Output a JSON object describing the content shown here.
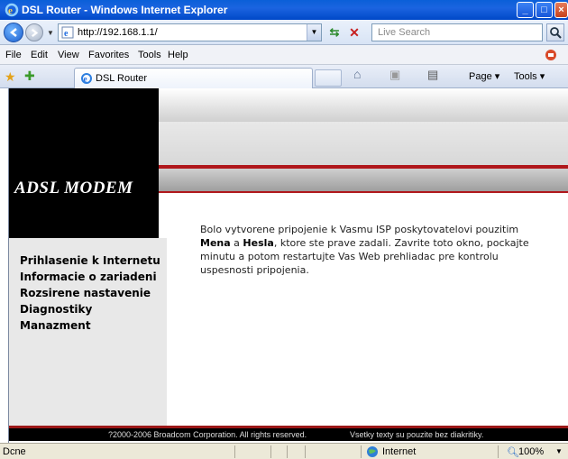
{
  "window": {
    "title": "DSL Router - Windows Internet Explorer",
    "min": "_",
    "max": "□",
    "close": "×"
  },
  "address": {
    "url": "http://192.168.1.1/",
    "search_placeholder": "Live Search"
  },
  "menu": {
    "items": [
      "File",
      "Edit",
      "View",
      "Favorites",
      "Tools",
      "Help"
    ]
  },
  "tab": {
    "label": "DSL Router"
  },
  "commands": {
    "page": "Page ▾",
    "tools": "Tools ▾"
  },
  "page": {
    "logo": "ADSL MODEM",
    "nav": [
      "Prihlasenie k Internetu",
      "Informacie o zariadeni",
      "Rozsirene nastavenie",
      "Diagnostiky",
      "Manazment"
    ],
    "message_part1": "Bolo vytvorene pripojenie k Vasmu ISP poskytovatelovi pouzitim ",
    "message_bold1": "Mena",
    "message_and": " a ",
    "message_bold2": "Hesla",
    "message_part2": ", ktore ste prave zadali. Zavrite toto okno, pockajte minutu a potom restartujte Vas Web prehliadac pre kontrolu uspesnosti pripojenia.",
    "footer_copyright": "?2000-2006 Broadcom Corporation. All rights reserved.",
    "footer_note": "Vsetky texty su pouzite bez diakritiky."
  },
  "status": {
    "text": "Dcne",
    "zone": "Internet",
    "zoom": "100%"
  },
  "colors": {
    "titlebar": "#0a5fd8",
    "accent_red": "#b0171b",
    "logo_bg": "#000000",
    "sidebar_bg": "#e8e8e8"
  },
  "icons": {
    "back": "back-arrow-icon",
    "forward": "forward-arrow-icon",
    "refresh": "refresh-icon",
    "stop": "stop-icon",
    "search": "search-icon",
    "home": "home-icon",
    "feeds": "feeds-icon",
    "print": "print-icon",
    "globe": "globe-icon"
  }
}
